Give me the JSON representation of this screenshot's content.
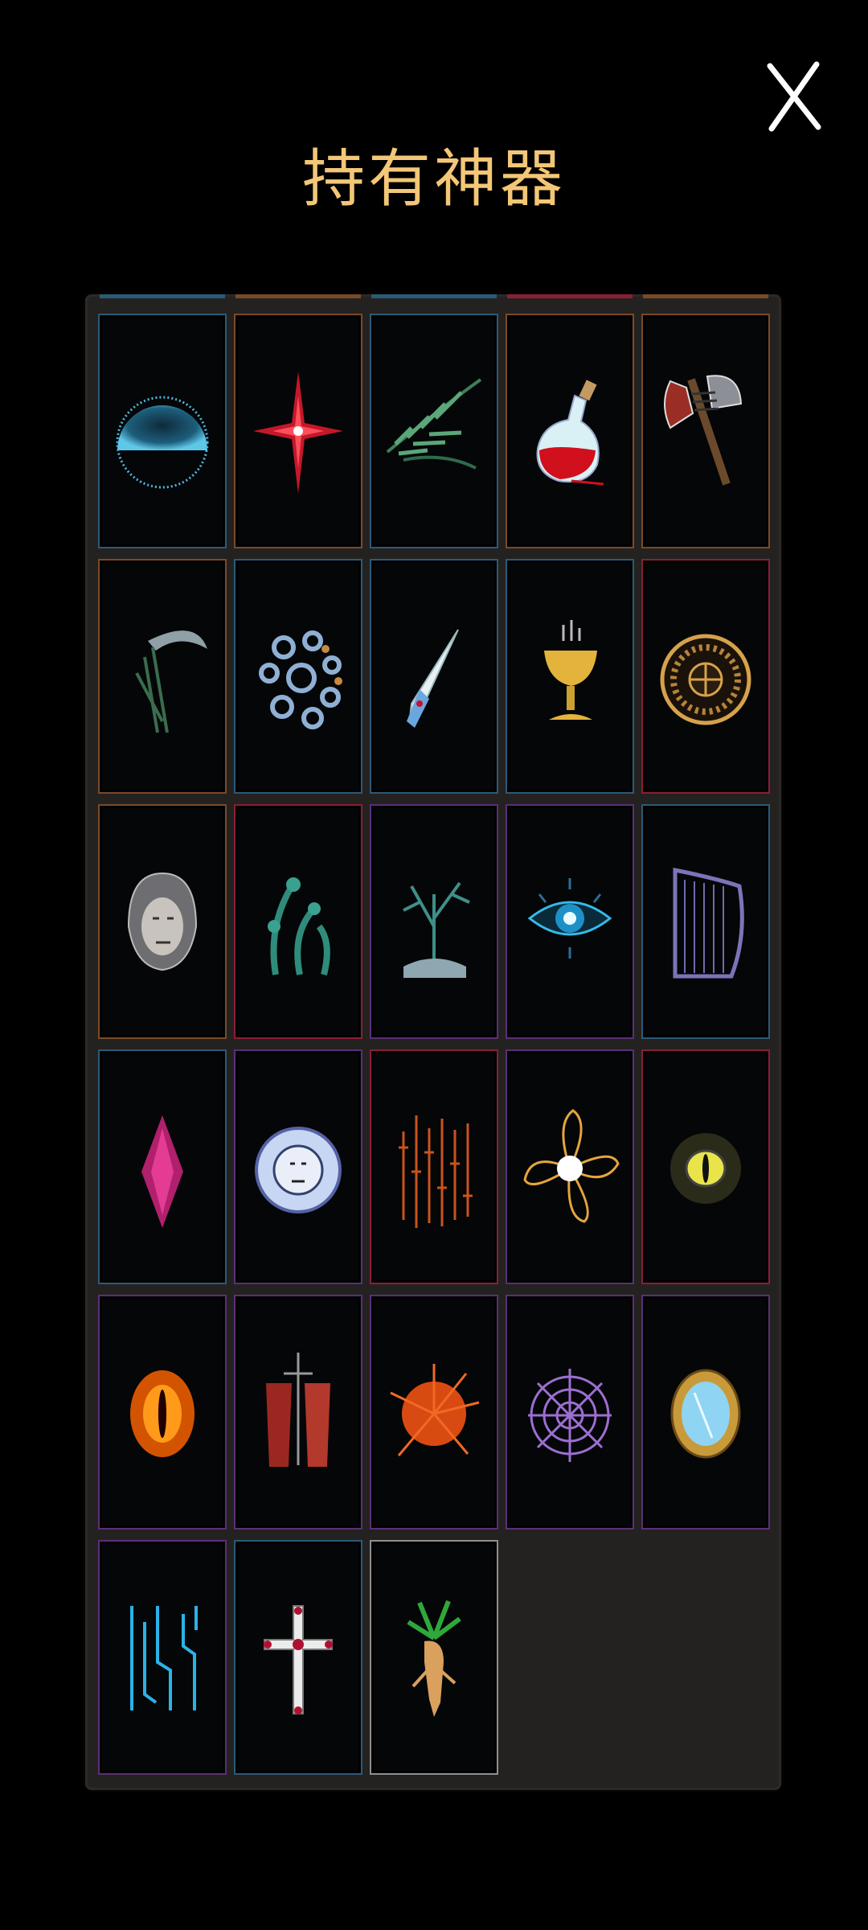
{
  "header": {
    "title": "持有神器",
    "close_icon": "close-x-icon"
  },
  "colors": {
    "background": "#000000",
    "title": "#f3c777",
    "panel": "#242220",
    "frame_blue": "#2b5a78",
    "frame_orange": "#7a4a28",
    "frame_red": "#8a1e35",
    "frame_purple": "#5a2f78",
    "frame_gray": "#8f8f8f"
  },
  "artifacts": [
    {
      "icon": "blue-orb-icon",
      "frame": "blue"
    },
    {
      "icon": "red-star-icon",
      "frame": "orange"
    },
    {
      "icon": "green-feather-icon",
      "frame": "blue"
    },
    {
      "icon": "red-potion-icon",
      "frame": "orange"
    },
    {
      "icon": "battle-axe-icon",
      "frame": "orange"
    },
    {
      "icon": "scythe-icon",
      "frame": "orange"
    },
    {
      "icon": "gears-icon",
      "frame": "blue"
    },
    {
      "icon": "crystal-dagger-icon",
      "frame": "blue"
    },
    {
      "icon": "golden-chalice-icon",
      "frame": "blue"
    },
    {
      "icon": "roulette-wheel-icon",
      "frame": "red"
    },
    {
      "icon": "stone-mask-icon",
      "frame": "orange"
    },
    {
      "icon": "serpent-heads-icon",
      "frame": "red"
    },
    {
      "icon": "coral-tree-icon",
      "frame": "purple"
    },
    {
      "icon": "all-seeing-eye-icon",
      "frame": "purple"
    },
    {
      "icon": "harp-icon",
      "frame": "blue"
    },
    {
      "icon": "pink-crystal-icon",
      "frame": "blue"
    },
    {
      "icon": "sun-face-medallion-icon",
      "frame": "purple"
    },
    {
      "icon": "orange-runes-icon",
      "frame": "red"
    },
    {
      "icon": "white-sun-burst-icon",
      "frame": "purple"
    },
    {
      "icon": "yellow-reptile-eye-icon",
      "frame": "red"
    },
    {
      "icon": "fiery-eye-icon",
      "frame": "purple"
    },
    {
      "icon": "bloody-banners-icon",
      "frame": "purple"
    },
    {
      "icon": "orange-explosion-icon",
      "frame": "purple"
    },
    {
      "icon": "spider-web-icon",
      "frame": "purple"
    },
    {
      "icon": "ornate-mirror-icon",
      "frame": "purple"
    },
    {
      "icon": "cyan-circuit-icon",
      "frame": "purple"
    },
    {
      "icon": "jeweled-cross-icon",
      "frame": "blue"
    },
    {
      "icon": "mandrake-root-icon",
      "frame": "gray"
    }
  ]
}
